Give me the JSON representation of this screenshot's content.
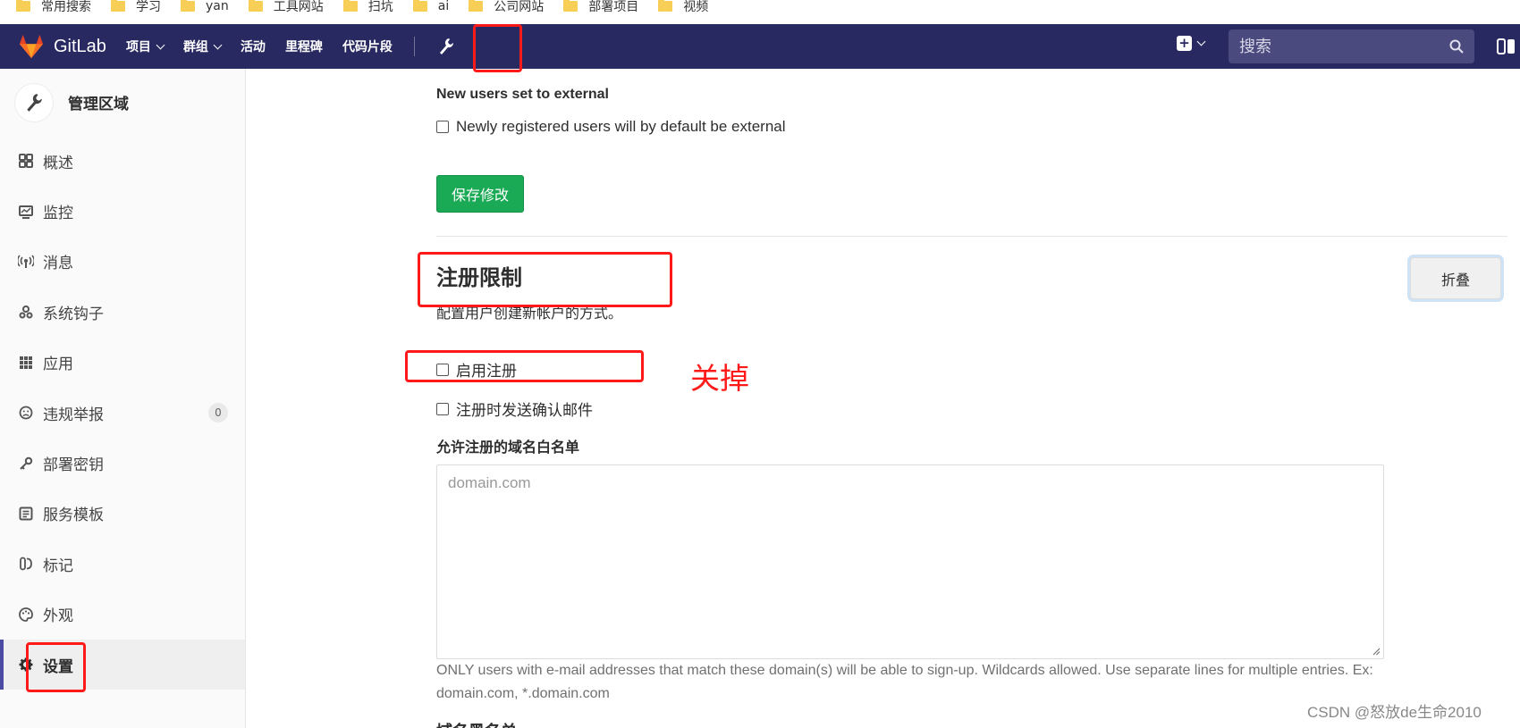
{
  "bookmarks": [
    "常用搜索",
    "学习",
    "yan",
    "工具网站",
    "扫坑",
    "ai",
    "公司网站",
    "部署项目",
    "视频"
  ],
  "topnav": {
    "brand": "GitLab",
    "items": [
      "项目",
      "群组",
      "活动",
      "里程碑",
      "代码片段"
    ],
    "search_placeholder": "搜索",
    "bg_color": "#292961"
  },
  "sidebar": {
    "title": "管理区域",
    "items": [
      {
        "label": "概述",
        "icon": "overview-icon"
      },
      {
        "label": "监控",
        "icon": "monitor-icon"
      },
      {
        "label": "消息",
        "icon": "broadcast-icon"
      },
      {
        "label": "系统钩子",
        "icon": "hook-icon"
      },
      {
        "label": "应用",
        "icon": "apps-icon"
      },
      {
        "label": "违规举报",
        "icon": "abuse-icon",
        "badge": "0"
      },
      {
        "label": "部署密钥",
        "icon": "key-icon"
      },
      {
        "label": "服务模板",
        "icon": "template-icon"
      },
      {
        "label": "标记",
        "icon": "labels-icon"
      },
      {
        "label": "外观",
        "icon": "palette-icon"
      },
      {
        "label": "设置",
        "icon": "gear-icon",
        "active": true
      }
    ]
  },
  "main": {
    "external_title": "New users set to external",
    "external_checkbox": "Newly registered users will by default be external",
    "save_label": "保存修改",
    "section_title": "注册限制",
    "section_desc": "配置用户创建新帐户的方式。",
    "collapse_label": "折叠",
    "enable_signup": "启用注册",
    "send_confirm": "注册时发送确认邮件",
    "whitelist_label": "允许注册的域名白名单",
    "whitelist_placeholder": "domain.com",
    "whitelist_help": "ONLY users with e-mail addresses that match these domain(s) will be able to sign-up. Wildcards allowed. Use separate lines for multiple entries. Ex: domain.com, *.domain.com",
    "next_heading_partial": "域名黑名单"
  },
  "annotation": {
    "text": "关掉",
    "color": "#ff1a1a"
  },
  "watermark": "CSDN @怒放de生命2010",
  "colors": {
    "save_button": "#1aaa55",
    "active_bar": "#4b4ba3"
  }
}
